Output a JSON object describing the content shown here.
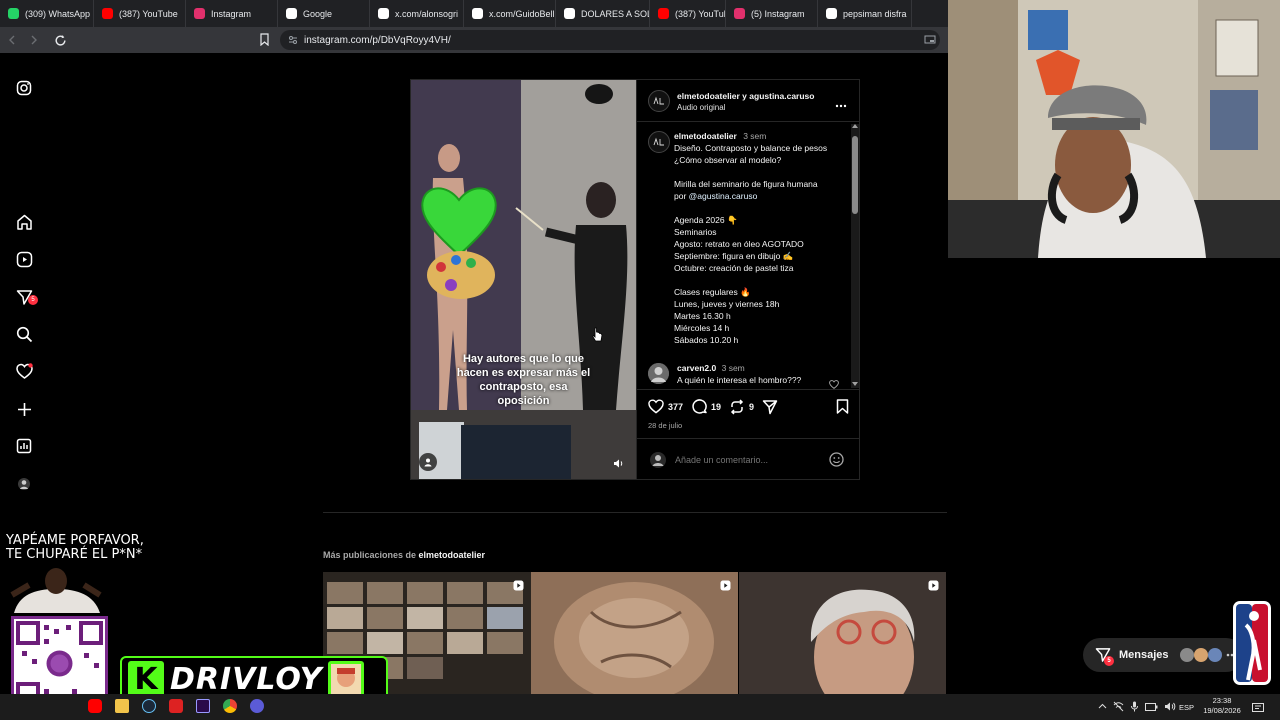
{
  "browser": {
    "tabs": [
      {
        "label": "(309) WhatsApp",
        "icon": "whatsapp-icon",
        "color": "#25d366"
      },
      {
        "label": "(387) YouTube",
        "icon": "youtube-icon",
        "color": "#ff0000"
      },
      {
        "label": "Instagram",
        "icon": "instagram-icon",
        "color": "#e1306c"
      },
      {
        "label": "Google",
        "icon": "google-icon",
        "color": "#ffffff"
      },
      {
        "label": "x.com/alonsogri",
        "icon": "x-icon",
        "color": "#ffffff"
      },
      {
        "label": "x.com/GuidoBell",
        "icon": "x-icon",
        "color": "#ffffff"
      },
      {
        "label": "DOLARES A SOL",
        "icon": "google-icon",
        "color": "#ffffff"
      },
      {
        "label": "(387) YouTube",
        "icon": "youtube-icon",
        "color": "#ff0000"
      },
      {
        "label": "(5) Instagram",
        "icon": "instagram-icon",
        "color": "#e1306c"
      },
      {
        "label": "pepsiman disfra",
        "icon": "google-icon",
        "color": "#ffffff"
      }
    ],
    "url": "instagram.com/p/DbVqRoyy4VH/"
  },
  "rail": {
    "notification_badge": "5"
  },
  "post": {
    "author_line": "elmetodoatelier y agustina.caruso",
    "audio": "Audio original",
    "video_caption": "Hay autores que lo que hacen es expresar más el contraposto, esa oposición",
    "caption_user": "elmetodoatelier",
    "caption_time": "3 sem",
    "caption_lines": [
      "Diseño. Contraposto y balance de pesos",
      "¿Cómo observar al modelo?",
      "",
      "Mirilla del seminario de figura humana",
      "por @agustina.caruso",
      "",
      "Agenda 2026 👇",
      "Seminarios",
      "Agosto: retrato en óleo AGOTADO",
      "Septiembre: figura en dibujo ✍️",
      "Octubre: creación de pastel tiza",
      "",
      "Clases regulares 🔥",
      "Lunes, jueves y viernes 18h",
      "Martes 16.30 h",
      "Miércoles 14 h",
      "Sábados 10.20 h"
    ],
    "comment_user": "carven2.0",
    "comment_time": "3 sem",
    "comment_text": "A quién le interesa el hombro???",
    "likes": "377",
    "comments": "19",
    "reposts": "9",
    "date": "28 de julio",
    "add_comment_placeholder": "Añade un comentario..."
  },
  "more": {
    "prefix": "Más publicaciones de ",
    "user": "elmetodoatelier"
  },
  "overlays": {
    "yape_line1": "YAPÉAME PORFAVOR,",
    "yape_line2": "TE CHUPARÉ  EL P*N*",
    "kick_letter": "K",
    "drivloy": "DRIVLOY",
    "messages_label": "Mensajes",
    "messages_badge": "5"
  },
  "taskbar": {
    "lang": "ESP",
    "time": "23:38",
    "date": "19/08/2026"
  }
}
